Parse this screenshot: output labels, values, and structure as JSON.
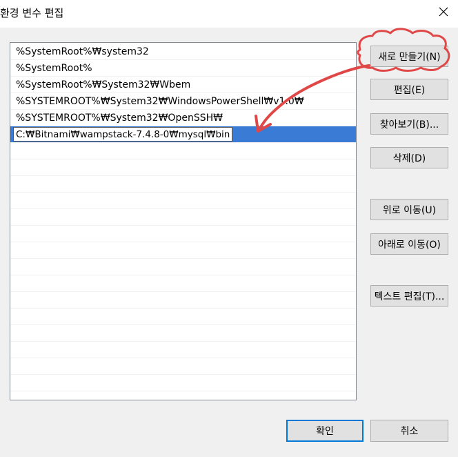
{
  "window": {
    "title": "환경 변수 편집",
    "close_icon": "close-icon"
  },
  "path_list": {
    "items": [
      "%SystemRoot%₩system32",
      "%SystemRoot%",
      "%SystemRoot%₩System32₩Wbem",
      "%SYSTEMROOT%₩System32₩WindowsPowerShell₩v1.0₩",
      "%SYSTEMROOT%₩System32₩OpenSSH₩"
    ],
    "editing_value": "C:₩Bitnami₩wampstack-7.4.8-0₩mysql₩bin",
    "selected_color": "#3a7bd5"
  },
  "buttons": {
    "new": "새로 만들기(N)",
    "edit": "편집(E)",
    "browse": "찾아보기(B)...",
    "delete": "삭제(D)",
    "move_up": "위로 이동(U)",
    "move_down": "아래로 이동(O)",
    "edit_text": "텍스트 편집(T)...",
    "ok": "확인",
    "cancel": "취소"
  },
  "annotation": {
    "color": "#e04848"
  }
}
